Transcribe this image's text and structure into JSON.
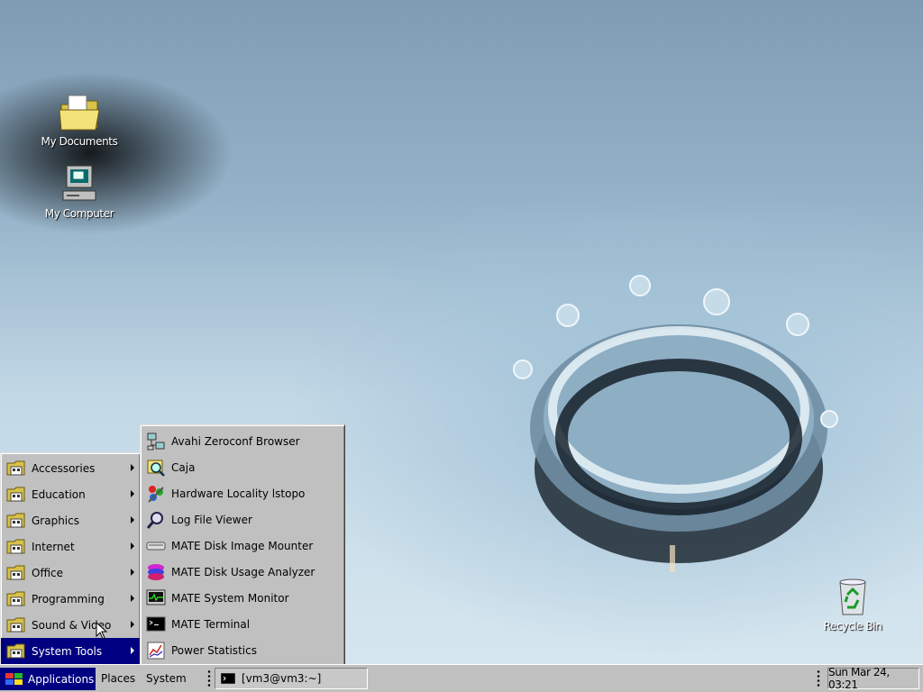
{
  "desktop": {
    "icons": [
      {
        "label": "My Documents",
        "icon": "folder-icon"
      },
      {
        "label": "My Computer",
        "icon": "computer-icon"
      },
      {
        "label": "Recycle Bin",
        "icon": "recycle-bin-icon"
      }
    ]
  },
  "applications_menu": {
    "items": [
      {
        "label": "Accessories",
        "has_submenu": true
      },
      {
        "label": "Education",
        "has_submenu": true
      },
      {
        "label": "Graphics",
        "has_submenu": true
      },
      {
        "label": "Internet",
        "has_submenu": true
      },
      {
        "label": "Office",
        "has_submenu": true
      },
      {
        "label": "Programming",
        "has_submenu": true
      },
      {
        "label": "Sound & Video",
        "has_submenu": true
      },
      {
        "label": "System Tools",
        "has_submenu": true,
        "active": true
      }
    ]
  },
  "system_tools_menu": {
    "items": [
      {
        "label": "Avahi Zeroconf Browser",
        "icon": "network-icon"
      },
      {
        "label": "Caja",
        "icon": "file-manager-icon"
      },
      {
        "label": "Hardware Locality lstopo",
        "icon": "hardware-icon"
      },
      {
        "label": "Log File Viewer",
        "icon": "log-viewer-icon"
      },
      {
        "label": "MATE Disk Image Mounter",
        "icon": "disk-mounter-icon"
      },
      {
        "label": "MATE Disk Usage Analyzer",
        "icon": "disk-usage-icon"
      },
      {
        "label": "MATE System Monitor",
        "icon": "system-monitor-icon"
      },
      {
        "label": "MATE Terminal",
        "icon": "terminal-icon"
      },
      {
        "label": "Power Statistics",
        "icon": "power-statistics-icon"
      }
    ]
  },
  "taskbar": {
    "applications_label": "Applications",
    "places_label": "Places",
    "system_label": "System",
    "task_label": "[vm3@vm3:~]",
    "clock": "Sun Mar 24, 03:21"
  },
  "colors": {
    "menu_bg": "#c0c0c0",
    "highlight": "#000080",
    "highlight_text": "#ffffff"
  }
}
